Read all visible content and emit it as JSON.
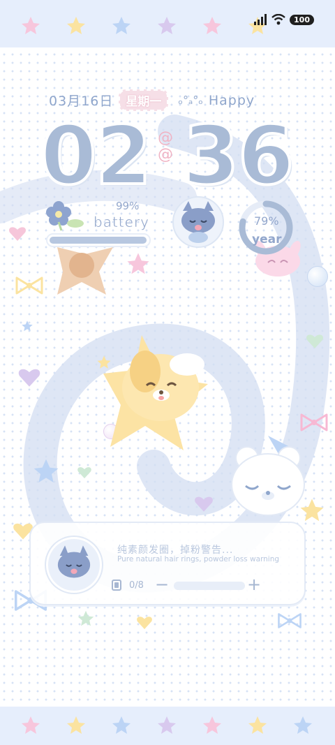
{
  "status_bar": {
    "battery_level": "100"
  },
  "lockscreen": {
    "date": "03月16日",
    "weekday": "星期一",
    "emoticon": "ₒ°ₐ°ₒ",
    "greeting": "Happy",
    "time": {
      "hours": "02",
      "minutes": "36"
    }
  },
  "widgets": {
    "battery": {
      "percent": "99%",
      "label": "battery",
      "level": 0.99
    },
    "year": {
      "percent": "79%",
      "label": "year",
      "progress": 0.79
    }
  },
  "music": {
    "title": "纯素颜发圈，掉粉警告...",
    "subtitle": "Pure natural hair rings, powder loss warning",
    "track_counter": "0/8",
    "minus_label": "−",
    "plus_label": "+"
  },
  "colors": {
    "band": "#e6eefc",
    "star_pink": "#f7c6dc",
    "star_yellow": "#fbe3a0",
    "star_blue": "#bcd4f5",
    "star_purple": "#d8c9ee",
    "digit": "#a9bbd6",
    "text": "#8fa6cc"
  },
  "icons": [
    "signal-icon",
    "wifi-icon",
    "battery-icon",
    "flower-icon",
    "cat-icon",
    "star-icon",
    "heart-icon",
    "bow-icon",
    "bubble-icon"
  ]
}
